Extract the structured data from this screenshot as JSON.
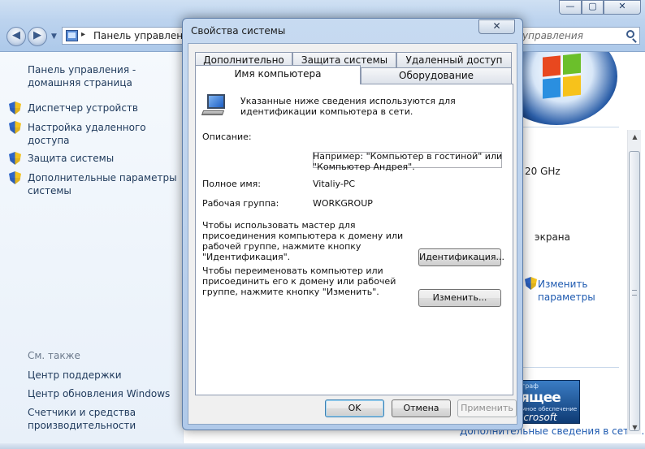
{
  "background_window": {
    "address_path": "Панель управления",
    "search_placeholder": "управления",
    "minimize": "—",
    "maximize": "▢",
    "close": "✕",
    "sidebar": {
      "home_link": "Панель управления -\nдомашняя страница",
      "items": [
        {
          "label": "Диспетчер устройств"
        },
        {
          "label": "Настройка удаленного\nдоступа"
        },
        {
          "label": "Защита системы"
        },
        {
          "label": "Дополнительные параметры\nсистемы"
        }
      ],
      "see_also": "См. также",
      "see_also_items": [
        {
          "label": "Центр поддержки"
        },
        {
          "label": "Центр обновления Windows"
        },
        {
          "label": "Счетчики и средства\nпроизводительности"
        }
      ]
    },
    "right": {
      "cpu_freq": "20 GHz",
      "screen_text": "экрана",
      "change_params": "Изменить\nпараметры",
      "badge_line1": "граф",
      "badge_line2": "ящее",
      "badge_line3": "мное обеспечение",
      "badge_line4": "icrosoft",
      "more_info": "Дополнительные сведения в сети..."
    }
  },
  "dialog": {
    "title": "Свойства системы",
    "close": "✕",
    "tabs": [
      {
        "label": "Дополнительно"
      },
      {
        "label": "Защита системы"
      },
      {
        "label": "Удаленный доступ"
      },
      {
        "label": "Оборудование"
      },
      {
        "label": "Имя компьютера",
        "active": true
      }
    ],
    "intro": "Указанные ниже сведения используются для\nидентификации компьютера в сети.",
    "description_label": "Описание:",
    "description_value": "",
    "example_text": "Например: \"Компьютер в гостиной\" или\n\"Компьютер Андрея\".",
    "full_name_label": "Полное имя:",
    "full_name_value": "Vitaliy-PC",
    "workgroup_label": "Рабочая группа:",
    "workgroup_value": "WORKGROUP",
    "identify_text": "Чтобы использовать мастер для\nприсоединения компьютера к домену или\nрабочей группе, нажмите кнопку\n\"Идентификация\".",
    "identify_button": "Идентификация...",
    "rename_text": "Чтобы переименовать компьютер или\nприсоединить его к домену или рабочей\nгруппе, нажмите кнопку \"Изменить\".",
    "change_button": "Изменить...",
    "ok_button": "OK",
    "cancel_button": "Отмена",
    "apply_button": "Применить"
  }
}
